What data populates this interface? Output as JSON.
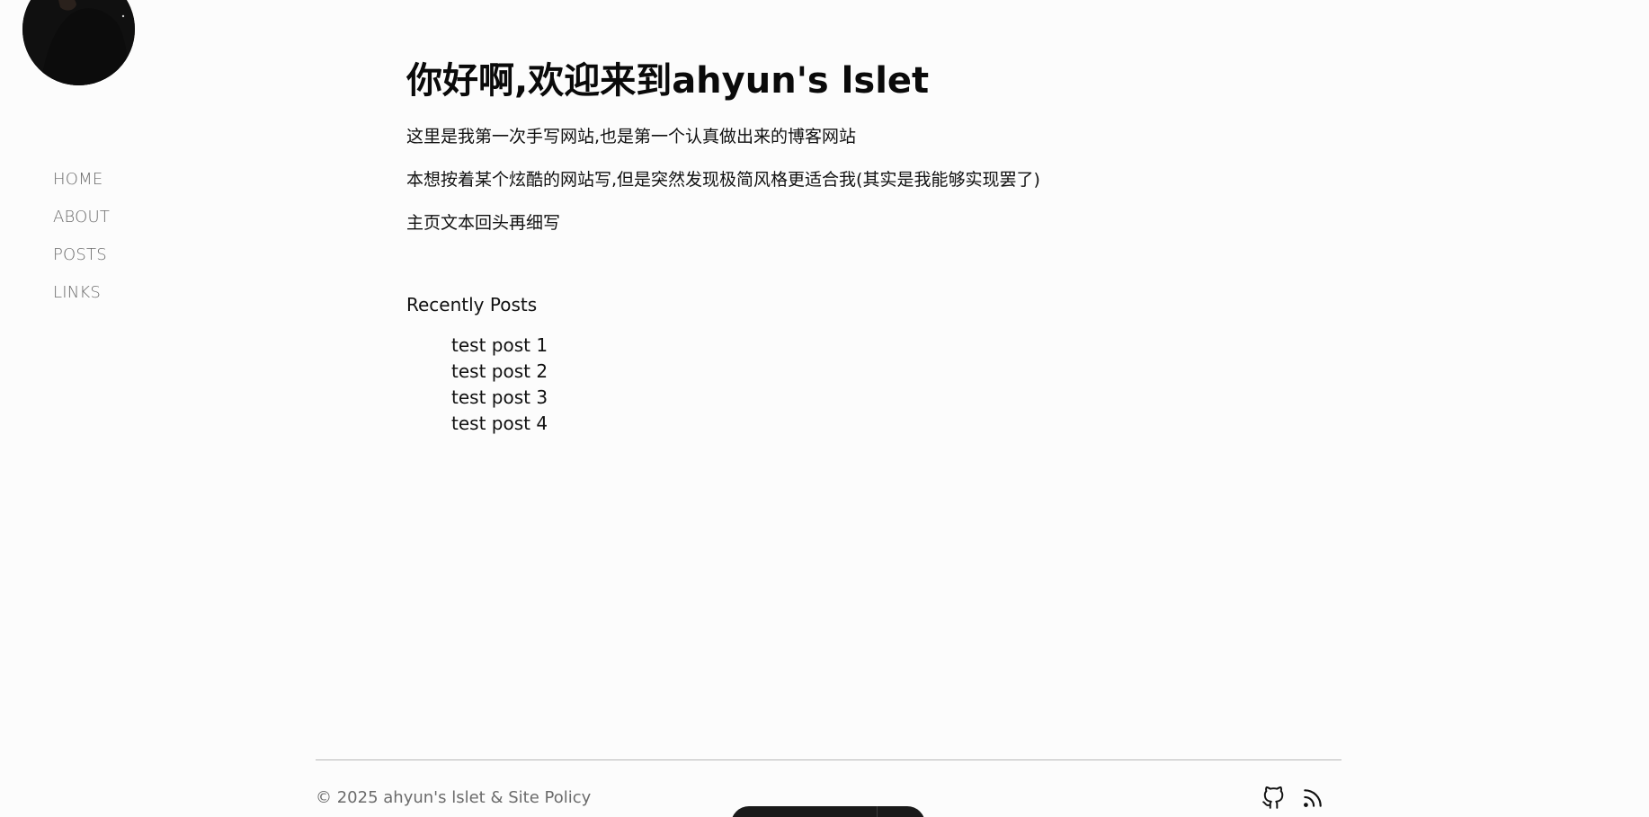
{
  "sidebar": {
    "avatar_alt": "avatar",
    "nav": [
      {
        "label": "HOME"
      },
      {
        "label": "ABOUT"
      },
      {
        "label": "POSTS"
      },
      {
        "label": "LINKS"
      }
    ]
  },
  "main": {
    "title": "你好啊,欢迎来到ahyun's lslet",
    "paragraphs": [
      "这里是我第一次手写网站,也是第一个认真做出来的博客网站",
      "本想按着某个炫酷的网站写,但是突然发现极简风格更适合我(其实是我能够实现罢了)",
      "主页文本回头再细写"
    ],
    "recent_heading": "Recently Posts",
    "recent_posts": [
      {
        "title": "test post 1"
      },
      {
        "title": "test post 2"
      },
      {
        "title": "test post 3"
      },
      {
        "title": "test post 4"
      }
    ]
  },
  "footer": {
    "copyright": "© 2025 ahyun's lslet & ",
    "policy_label": "Site Policy",
    "icons": [
      "github-icon",
      "rss-icon"
    ]
  },
  "colors": {
    "background": "#fcfcfc",
    "text": "#111111",
    "muted": "#6b6b6b",
    "rule": "#b8b8b8"
  }
}
